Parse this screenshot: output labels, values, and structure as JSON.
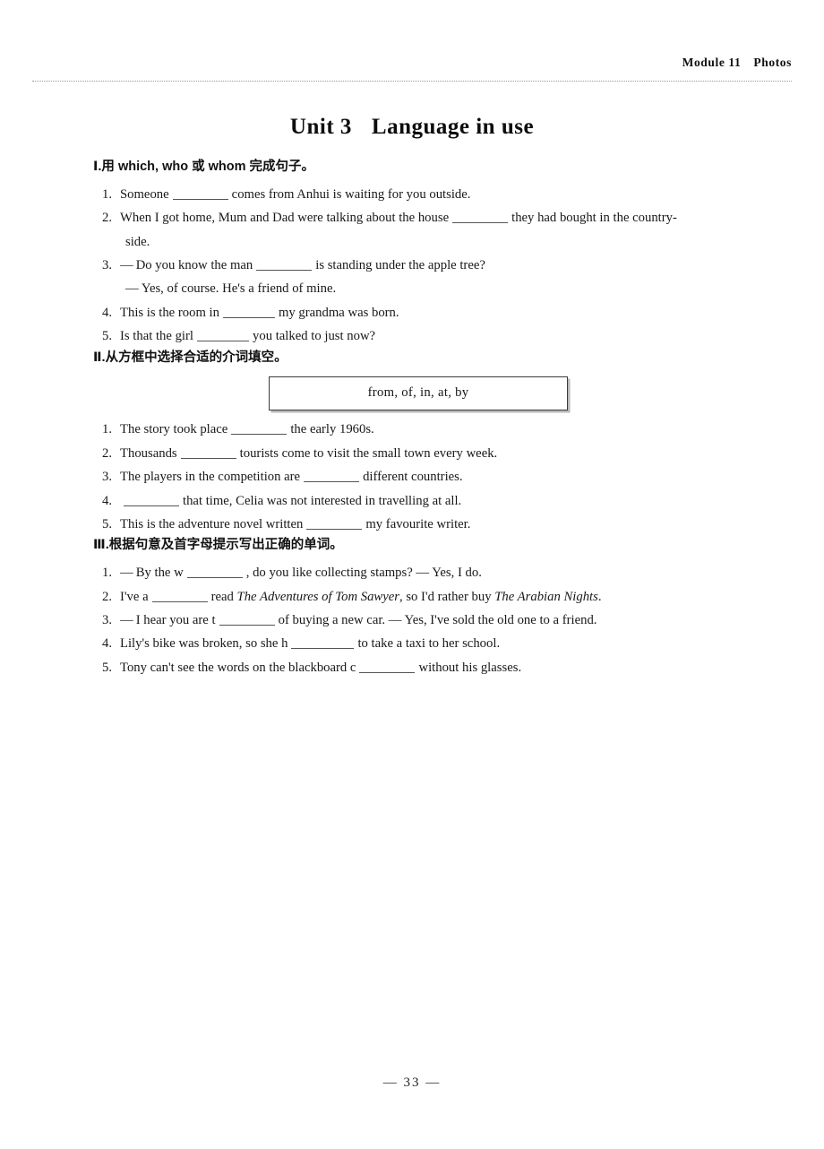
{
  "header": {
    "module": "Module 11",
    "topic": "Photos"
  },
  "title": {
    "unit": "Unit 3",
    "name": "Language in use"
  },
  "sections": [
    {
      "roman": "Ⅰ",
      "dot": ".",
      "head_cn_1": "用 ",
      "head_en": "which, who 或 whom",
      "head_cn_2": " 完成句子。",
      "head_full": "Ⅰ.用 which, who 或 whom 完成句子。",
      "items": [
        {
          "num": "1.",
          "pre": "Someone",
          "post": "comes from Anhui is waiting for you outside."
        },
        {
          "num": "2.",
          "pre": "When I got home, Mum and Dad were talking about the house",
          "post": "they had bought in the country-",
          "line2": "side."
        },
        {
          "num": "3.",
          "dash": "—",
          "pre": "Do you know the man",
          "post": "is standing under the apple tree?",
          "line2": "— Yes, of course.  He's a friend of mine."
        },
        {
          "num": "4.",
          "pre": "This is the room in",
          "post": "my grandma was born."
        },
        {
          "num": "5.",
          "pre": "Is that the girl",
          "post": "you talked to just now?"
        }
      ]
    },
    {
      "roman": "Ⅱ",
      "dot": ".",
      "head_full": "Ⅱ.从方框中选择合适的介词填空。",
      "wordbox": "from, of, in, at, by",
      "items": [
        {
          "num": "1.",
          "pre": "The story took place",
          "post": "the early 1960s."
        },
        {
          "num": "2.",
          "pre": "Thousands",
          "post": "tourists come to visit the small town every week."
        },
        {
          "num": "3.",
          "pre": "The players in the competition are",
          "post": "different countries."
        },
        {
          "num": "4.",
          "pre": "",
          "post": "that time, Celia was not interested in travelling at all."
        },
        {
          "num": "5.",
          "pre": "This is the adventure novel written",
          "post": "my favourite writer."
        }
      ]
    },
    {
      "roman": "Ⅲ",
      "dot": ".",
      "head_full": "Ⅲ.根据句意及首字母提示写出正确的单词。",
      "items": [
        {
          "num": "1.",
          "dash": "—",
          "pre": "By the w",
          "post": ", do you like collecting stamps?  — Yes, I do."
        },
        {
          "num": "2.",
          "pre": "I've a",
          "mid": "read",
          "book1": "The Adventures of Tom Sawyer",
          "mid2": ", so I'd rather buy",
          "book2": "The Arabian Nights",
          "post": "."
        },
        {
          "num": "3.",
          "dash": "—",
          "pre": "I hear you are t",
          "post": "of buying a new car.  — Yes, I've sold the old one to a friend."
        },
        {
          "num": "4.",
          "pre": "Lily's bike was broken, so she h",
          "post": "to take a taxi to her school."
        },
        {
          "num": "5.",
          "pre": "Tony can't see the words on the blackboard c",
          "post": "without his glasses."
        }
      ]
    }
  ],
  "footer": {
    "page_number": "— 33 —"
  }
}
